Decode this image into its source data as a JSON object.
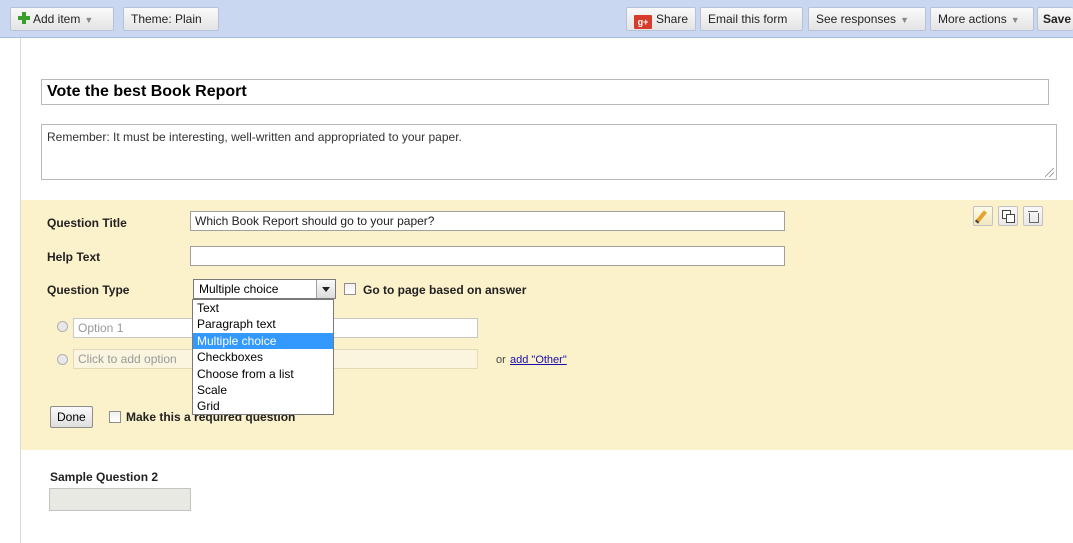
{
  "toolbar": {
    "add_item": "Add item",
    "theme": "Theme:  Plain",
    "share": "Share",
    "share_icon_text": "g+",
    "email": "Email this form",
    "see_responses": "See responses",
    "more_actions": "More actions",
    "save": "Save",
    "dropdown_arrow": "▼"
  },
  "form": {
    "title": "Vote the best Book Report",
    "description": "Remember: It must be interesting, well-written and appropriated to your paper."
  },
  "question": {
    "title_label": "Question Title",
    "title_value": "Which Book Report should go to your paper?",
    "help_label": "Help Text",
    "help_value": "",
    "type_label": "Question Type",
    "type_value": "Multiple choice",
    "goto_page_label": "Go to page based on answer",
    "option1_placeholder": "Option 1",
    "add_option_placeholder": "Click to add option",
    "or_text": "or",
    "add_other_link": "add \"Other\"",
    "done_label": "Done",
    "required_label": "Make this a required question",
    "type_options": [
      "Text",
      "Paragraph text",
      "Multiple choice",
      "Checkboxes",
      "Choose from a list",
      "Scale",
      "Grid"
    ],
    "selected_option_index": 2
  },
  "sample_question_2": {
    "label": "Sample Question 2"
  },
  "colors": {
    "toolbar_bg": "#c9d7f1",
    "editor_bg": "#fbf1cb",
    "selection": "#3399ff",
    "link": "#1a0dab"
  },
  "icons": [
    "plus-icon",
    "google-plus-icon",
    "pencil-icon",
    "copy-icon",
    "trash-icon",
    "chevron-down-icon",
    "resize-grip-icon"
  ]
}
